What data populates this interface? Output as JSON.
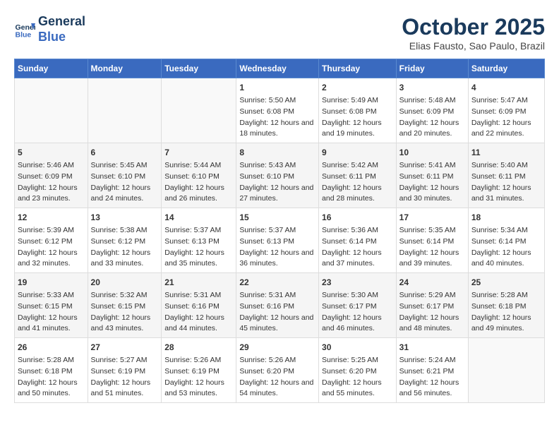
{
  "header": {
    "logo_line1": "General",
    "logo_line2": "Blue",
    "month_title": "October 2025",
    "location": "Elias Fausto, Sao Paulo, Brazil"
  },
  "days_of_week": [
    "Sunday",
    "Monday",
    "Tuesday",
    "Wednesday",
    "Thursday",
    "Friday",
    "Saturday"
  ],
  "weeks": [
    [
      {
        "day": "",
        "sunrise": "",
        "sunset": "",
        "daylight": ""
      },
      {
        "day": "",
        "sunrise": "",
        "sunset": "",
        "daylight": ""
      },
      {
        "day": "",
        "sunrise": "",
        "sunset": "",
        "daylight": ""
      },
      {
        "day": "1",
        "sunrise": "Sunrise: 5:50 AM",
        "sunset": "Sunset: 6:08 PM",
        "daylight": "Daylight: 12 hours and 18 minutes."
      },
      {
        "day": "2",
        "sunrise": "Sunrise: 5:49 AM",
        "sunset": "Sunset: 6:08 PM",
        "daylight": "Daylight: 12 hours and 19 minutes."
      },
      {
        "day": "3",
        "sunrise": "Sunrise: 5:48 AM",
        "sunset": "Sunset: 6:09 PM",
        "daylight": "Daylight: 12 hours and 20 minutes."
      },
      {
        "day": "4",
        "sunrise": "Sunrise: 5:47 AM",
        "sunset": "Sunset: 6:09 PM",
        "daylight": "Daylight: 12 hours and 22 minutes."
      }
    ],
    [
      {
        "day": "5",
        "sunrise": "Sunrise: 5:46 AM",
        "sunset": "Sunset: 6:09 PM",
        "daylight": "Daylight: 12 hours and 23 minutes."
      },
      {
        "day": "6",
        "sunrise": "Sunrise: 5:45 AM",
        "sunset": "Sunset: 6:10 PM",
        "daylight": "Daylight: 12 hours and 24 minutes."
      },
      {
        "day": "7",
        "sunrise": "Sunrise: 5:44 AM",
        "sunset": "Sunset: 6:10 PM",
        "daylight": "Daylight: 12 hours and 26 minutes."
      },
      {
        "day": "8",
        "sunrise": "Sunrise: 5:43 AM",
        "sunset": "Sunset: 6:10 PM",
        "daylight": "Daylight: 12 hours and 27 minutes."
      },
      {
        "day": "9",
        "sunrise": "Sunrise: 5:42 AM",
        "sunset": "Sunset: 6:11 PM",
        "daylight": "Daylight: 12 hours and 28 minutes."
      },
      {
        "day": "10",
        "sunrise": "Sunrise: 5:41 AM",
        "sunset": "Sunset: 6:11 PM",
        "daylight": "Daylight: 12 hours and 30 minutes."
      },
      {
        "day": "11",
        "sunrise": "Sunrise: 5:40 AM",
        "sunset": "Sunset: 6:11 PM",
        "daylight": "Daylight: 12 hours and 31 minutes."
      }
    ],
    [
      {
        "day": "12",
        "sunrise": "Sunrise: 5:39 AM",
        "sunset": "Sunset: 6:12 PM",
        "daylight": "Daylight: 12 hours and 32 minutes."
      },
      {
        "day": "13",
        "sunrise": "Sunrise: 5:38 AM",
        "sunset": "Sunset: 6:12 PM",
        "daylight": "Daylight: 12 hours and 33 minutes."
      },
      {
        "day": "14",
        "sunrise": "Sunrise: 5:37 AM",
        "sunset": "Sunset: 6:13 PM",
        "daylight": "Daylight: 12 hours and 35 minutes."
      },
      {
        "day": "15",
        "sunrise": "Sunrise: 5:37 AM",
        "sunset": "Sunset: 6:13 PM",
        "daylight": "Daylight: 12 hours and 36 minutes."
      },
      {
        "day": "16",
        "sunrise": "Sunrise: 5:36 AM",
        "sunset": "Sunset: 6:14 PM",
        "daylight": "Daylight: 12 hours and 37 minutes."
      },
      {
        "day": "17",
        "sunrise": "Sunrise: 5:35 AM",
        "sunset": "Sunset: 6:14 PM",
        "daylight": "Daylight: 12 hours and 39 minutes."
      },
      {
        "day": "18",
        "sunrise": "Sunrise: 5:34 AM",
        "sunset": "Sunset: 6:14 PM",
        "daylight": "Daylight: 12 hours and 40 minutes."
      }
    ],
    [
      {
        "day": "19",
        "sunrise": "Sunrise: 5:33 AM",
        "sunset": "Sunset: 6:15 PM",
        "daylight": "Daylight: 12 hours and 41 minutes."
      },
      {
        "day": "20",
        "sunrise": "Sunrise: 5:32 AM",
        "sunset": "Sunset: 6:15 PM",
        "daylight": "Daylight: 12 hours and 43 minutes."
      },
      {
        "day": "21",
        "sunrise": "Sunrise: 5:31 AM",
        "sunset": "Sunset: 6:16 PM",
        "daylight": "Daylight: 12 hours and 44 minutes."
      },
      {
        "day": "22",
        "sunrise": "Sunrise: 5:31 AM",
        "sunset": "Sunset: 6:16 PM",
        "daylight": "Daylight: 12 hours and 45 minutes."
      },
      {
        "day": "23",
        "sunrise": "Sunrise: 5:30 AM",
        "sunset": "Sunset: 6:17 PM",
        "daylight": "Daylight: 12 hours and 46 minutes."
      },
      {
        "day": "24",
        "sunrise": "Sunrise: 5:29 AM",
        "sunset": "Sunset: 6:17 PM",
        "daylight": "Daylight: 12 hours and 48 minutes."
      },
      {
        "day": "25",
        "sunrise": "Sunrise: 5:28 AM",
        "sunset": "Sunset: 6:18 PM",
        "daylight": "Daylight: 12 hours and 49 minutes."
      }
    ],
    [
      {
        "day": "26",
        "sunrise": "Sunrise: 5:28 AM",
        "sunset": "Sunset: 6:18 PM",
        "daylight": "Daylight: 12 hours and 50 minutes."
      },
      {
        "day": "27",
        "sunrise": "Sunrise: 5:27 AM",
        "sunset": "Sunset: 6:19 PM",
        "daylight": "Daylight: 12 hours and 51 minutes."
      },
      {
        "day": "28",
        "sunrise": "Sunrise: 5:26 AM",
        "sunset": "Sunset: 6:19 PM",
        "daylight": "Daylight: 12 hours and 53 minutes."
      },
      {
        "day": "29",
        "sunrise": "Sunrise: 5:26 AM",
        "sunset": "Sunset: 6:20 PM",
        "daylight": "Daylight: 12 hours and 54 minutes."
      },
      {
        "day": "30",
        "sunrise": "Sunrise: 5:25 AM",
        "sunset": "Sunset: 6:20 PM",
        "daylight": "Daylight: 12 hours and 55 minutes."
      },
      {
        "day": "31",
        "sunrise": "Sunrise: 5:24 AM",
        "sunset": "Sunset: 6:21 PM",
        "daylight": "Daylight: 12 hours and 56 minutes."
      },
      {
        "day": "",
        "sunrise": "",
        "sunset": "",
        "daylight": ""
      }
    ]
  ]
}
